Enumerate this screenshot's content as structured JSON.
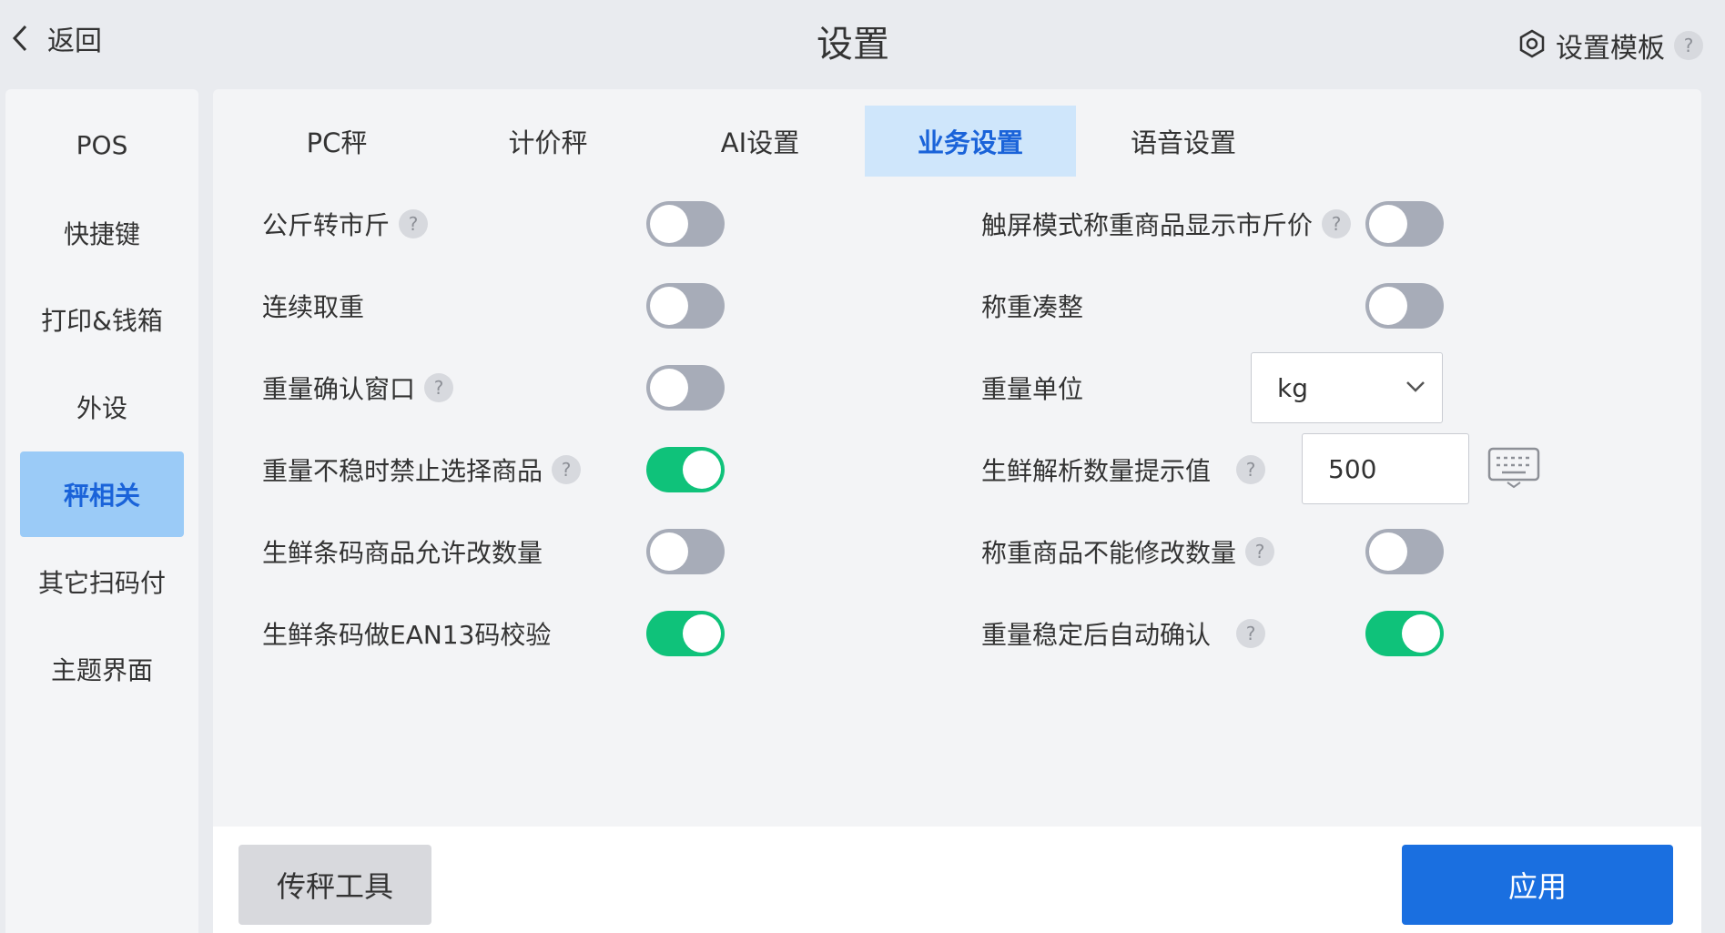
{
  "header": {
    "back_label": "返回",
    "title": "设置",
    "template_label": "设置模板",
    "help_glyph": "?"
  },
  "sidebar": {
    "items": [
      {
        "label": "POS",
        "active": false
      },
      {
        "label": "快捷键",
        "active": false
      },
      {
        "label": "打印&钱箱",
        "active": false
      },
      {
        "label": "外设",
        "active": false
      },
      {
        "label": "秤相关",
        "active": true
      },
      {
        "label": "其它扫码付",
        "active": false
      },
      {
        "label": "主题界面",
        "active": false
      }
    ]
  },
  "tabs": [
    {
      "label": "PC秤",
      "active": false
    },
    {
      "label": "计价秤",
      "active": false
    },
    {
      "label": "AI设置",
      "active": false
    },
    {
      "label": "业务设置",
      "active": true
    },
    {
      "label": "语音设置",
      "active": false
    }
  ],
  "settings_left": [
    {
      "label": "公斤转市斤",
      "help": true,
      "enabled": false
    },
    {
      "label": "连续取重",
      "help": false,
      "enabled": false
    },
    {
      "label": "重量确认窗口",
      "help": true,
      "enabled": false
    },
    {
      "label": "重量不稳时禁止选择商品",
      "help": true,
      "enabled": true
    },
    {
      "label": "生鲜条码商品允许改数量",
      "help": false,
      "enabled": false
    },
    {
      "label": "生鲜条码做EAN13码校验",
      "help": false,
      "enabled": true
    }
  ],
  "settings_right": [
    {
      "label": "触屏模式称重商品显示市斤价",
      "help": true,
      "enabled": false
    },
    {
      "label": "称重凑整",
      "help": false,
      "enabled": false
    },
    {
      "label": "重量单位",
      "help": false,
      "control": "select",
      "value": "kg"
    },
    {
      "label": "生鲜解析数量提示值",
      "help": true,
      "control": "input",
      "value": "500"
    },
    {
      "label": "称重商品不能修改数量",
      "help": true,
      "enabled": false
    },
    {
      "label": "重量稳定后自动确认",
      "help": true,
      "enabled": true
    }
  ],
  "footer": {
    "tool_button": "传秤工具",
    "apply_button": "应用"
  },
  "colors": {
    "accent": "#1a6fe0",
    "toggle_on": "#0fc27a",
    "toggle_off": "#a7acb8",
    "sidebar_active_bg": "#9bcbf7",
    "tab_active_bg": "#cfe6fb"
  },
  "icons": {
    "back": "chevron-left-icon",
    "template": "hexagon-settings-icon",
    "select": "chevron-down-icon",
    "keyboard": "keyboard-icon"
  }
}
